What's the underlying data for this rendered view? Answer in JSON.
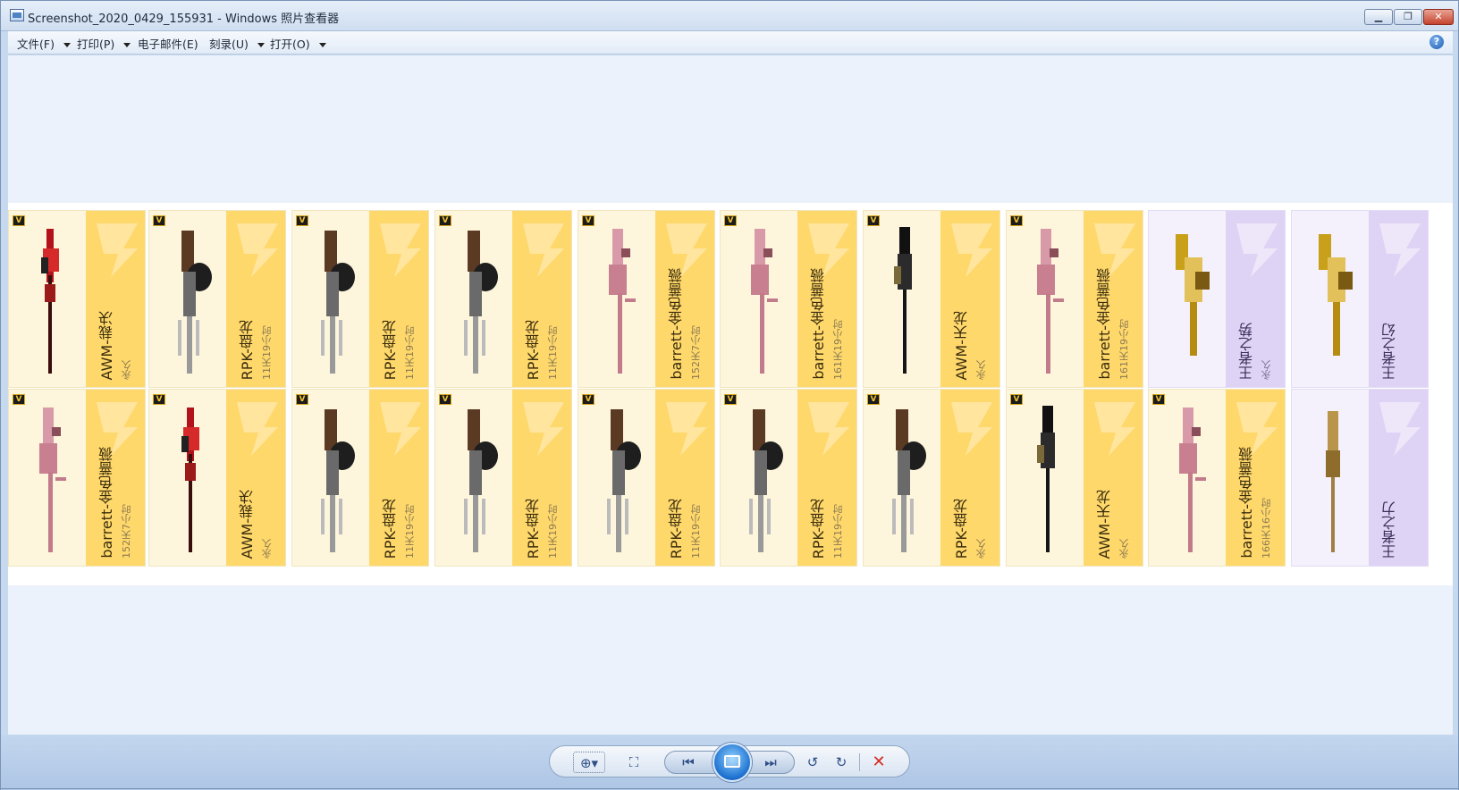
{
  "window": {
    "title": "Screenshot_2020_0429_155931 - Windows 照片查看器",
    "buttons": {
      "minimize": "▁",
      "maximize": "❐",
      "close": "✕"
    }
  },
  "menu": {
    "items": [
      {
        "label": "文件(F)",
        "has_dropdown": true
      },
      {
        "label": "打印(P)",
        "has_dropdown": true
      },
      {
        "label": "电子邮件(E)",
        "has_dropdown": false
      },
      {
        "label": "刻录(U)",
        "has_dropdown": true
      },
      {
        "label": "打开(O)",
        "has_dropdown": true
      }
    ],
    "help": "?"
  },
  "photo": {
    "vip_badge": "V",
    "row1": [
      {
        "name": "AWM-裁决",
        "duration": "永久",
        "theme": "gold",
        "weapon": "sniper-red"
      },
      {
        "name": "RPK-盘龙",
        "duration": "11天19小时",
        "theme": "gold",
        "weapon": "rpk"
      },
      {
        "name": "RPK-盘龙",
        "duration": "11天19小时",
        "theme": "gold",
        "weapon": "rpk"
      },
      {
        "name": "RPK-盘龙",
        "duration": "11天19小时",
        "theme": "gold",
        "weapon": "rpk"
      },
      {
        "name": "barrett-金色蔷薇",
        "duration": "152天7小时",
        "theme": "gold",
        "weapon": "barrett-pink"
      },
      {
        "name": "barrett-金色蔷薇",
        "duration": "161天19小时",
        "theme": "gold",
        "weapon": "barrett-pink"
      },
      {
        "name": "AWM-天龙",
        "duration": "永久",
        "theme": "gold",
        "weapon": "sniper-black"
      },
      {
        "name": "barrett-金色蔷薇",
        "duration": "161天19小时",
        "theme": "gold",
        "weapon": "barrett-pink"
      },
      {
        "name": "王者之势",
        "duration": "永久",
        "theme": "purple",
        "weapon": "rifle-gold"
      },
      {
        "name": "王者之幻",
        "duration": "",
        "theme": "purple",
        "weapon": "rifle-gold"
      }
    ],
    "row2": [
      {
        "name": "barrett-金色蔷薇",
        "duration": "152天7小时",
        "theme": "gold",
        "weapon": "barrett-pink"
      },
      {
        "name": "AWM-裁决",
        "duration": "永久",
        "theme": "gold",
        "weapon": "sniper-red"
      },
      {
        "name": "RPK-盘龙",
        "duration": "11天19小时",
        "theme": "gold",
        "weapon": "rpk"
      },
      {
        "name": "RPK-盘龙",
        "duration": "11天19小时",
        "theme": "gold",
        "weapon": "rpk"
      },
      {
        "name": "RPK-盘龙",
        "duration": "11天19小时",
        "theme": "gold",
        "weapon": "rpk"
      },
      {
        "name": "RPK-盘龙",
        "duration": "11天19小时",
        "theme": "gold",
        "weapon": "rpk"
      },
      {
        "name": "RPK-盘龙",
        "duration": "永久",
        "theme": "gold",
        "weapon": "rpk"
      },
      {
        "name": "AWM-天龙",
        "duration": "永久",
        "theme": "gold",
        "weapon": "sniper-black"
      },
      {
        "name": "barrett-金色蔷薇",
        "duration": "166天16小时",
        "theme": "gold",
        "weapon": "barrett-pink"
      },
      {
        "name": "王者之力",
        "duration": "",
        "theme": "purple",
        "weapon": "sniper-gold"
      }
    ]
  },
  "toolbar": {
    "zoom": "⊕▾",
    "actual_size": "⛶",
    "previous": "⏮",
    "next": "⏭",
    "rotate_ccw": "↺",
    "rotate_cw": "↻",
    "delete": "✕"
  },
  "colors": {
    "card_gold": "#ffd86b",
    "card_purple": "#dfd3f5",
    "viewer_bg": "#ebf2fb",
    "delete_red": "#d32b1f"
  }
}
